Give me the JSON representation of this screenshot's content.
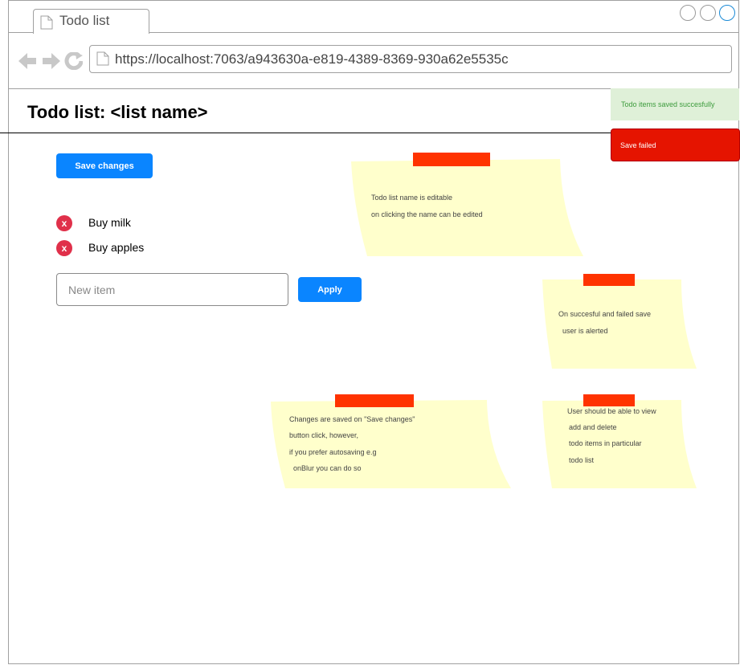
{
  "browser": {
    "tab_title": "Todo list",
    "url": "https://localhost:7063/a943630a-e819-4389-8369-930a62e5535c"
  },
  "page": {
    "title": "Todo list: <list name>",
    "save_button": "Save changes",
    "todo_items": [
      "Buy milk",
      "Buy apples"
    ],
    "delete_icon_glyph": "x",
    "new_item_placeholder": "New item",
    "apply_button": "Apply"
  },
  "toasts": {
    "success": "Todo items saved succesfully",
    "error": "Save failed"
  },
  "notes": [
    {
      "lines": [
        "Todo list name is editable",
        "on clicking the name can be edited"
      ]
    },
    {
      "lines": [
        "On succesful and failed save",
        "user is alerted"
      ]
    },
    {
      "lines": [
        "Changes are saved on \"Save changes\"",
        "button click, however,",
        "if you prefer autosaving e.g",
        "onBlur you can do so"
      ]
    },
    {
      "lines": [
        "User should be able to view",
        "add and delete",
        "todo items in particular",
        "todo list"
      ]
    }
  ],
  "colors": {
    "primary_button": "#0a85ff",
    "delete_icon": "#e0304a",
    "note_paper": "#ffffcc",
    "note_tape": "#ff3300",
    "success_bg": "#dff0d8",
    "error_bg": "#e51400"
  },
  "icons": [
    "document-icon",
    "back-arrow-icon",
    "forward-arrow-icon",
    "reload-icon",
    "window-button-icon",
    "delete-icon"
  ]
}
